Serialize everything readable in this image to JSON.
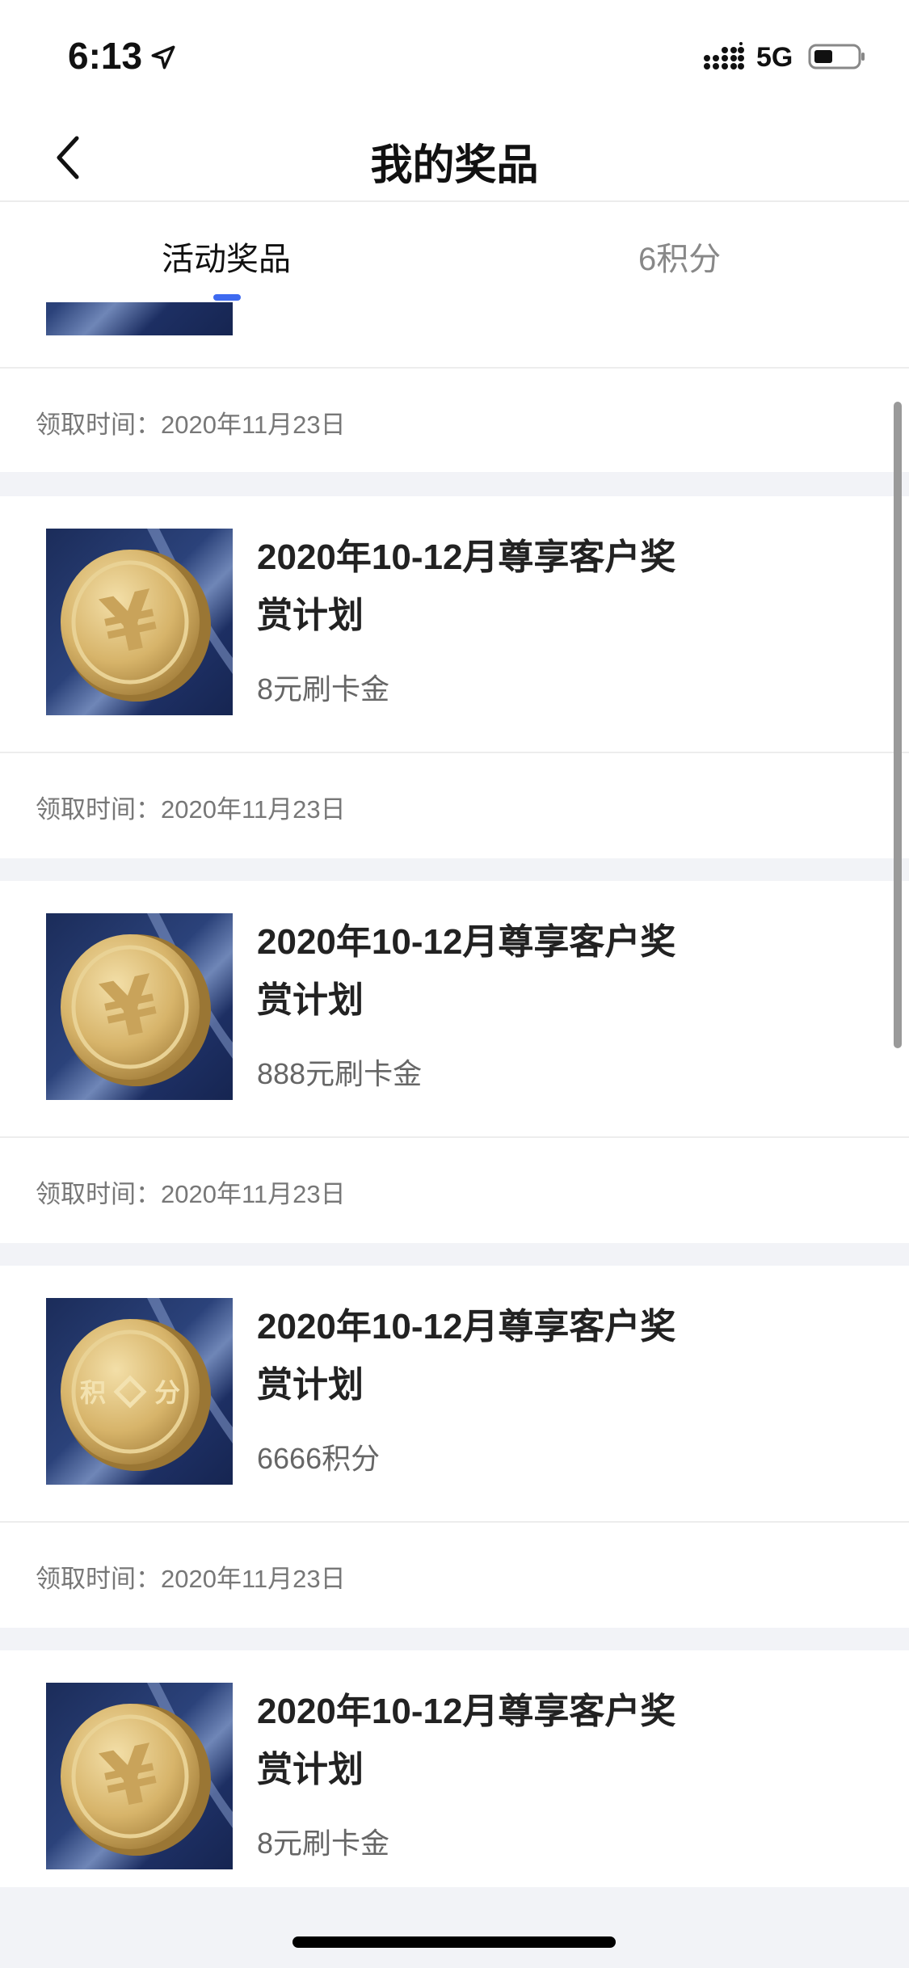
{
  "status_bar": {
    "time": "6:13",
    "network": "5G",
    "icons": [
      "location-arrow-icon",
      "signal-icon",
      "battery-icon"
    ]
  },
  "nav": {
    "title": "我的奖品",
    "back_icon": "chevron-left-icon"
  },
  "tabs": [
    {
      "label": "活动奖品",
      "active": true
    },
    {
      "label": "6积分",
      "active": false
    }
  ],
  "colors": {
    "accent": "#3e6af0",
    "background": "#f2f3f7"
  },
  "items": [
    {
      "claim_label": "领取时间：",
      "claim_date": "2020年11月23日",
      "partial": true
    },
    {
      "title": "2020年10-12月尊享客户奖赏计划",
      "reward": "8元刷卡金",
      "claim_label": "领取时间：",
      "claim_date": "2020年11月23日",
      "coin": "yuan"
    },
    {
      "title": "2020年10-12月尊享客户奖赏计划",
      "reward": "888元刷卡金",
      "claim_label": "领取时间：",
      "claim_date": "2020年11月23日",
      "coin": "yuan"
    },
    {
      "title": "2020年10-12月尊享客户奖赏计划",
      "reward": "6666积分",
      "claim_label": "领取时间：",
      "claim_date": "2020年11月23日",
      "coin": "points",
      "coin_text_left": "积",
      "coin_text_right": "分"
    },
    {
      "title": "2020年10-12月尊享客户奖赏计划",
      "reward": "8元刷卡金",
      "coin": "yuan"
    }
  ]
}
